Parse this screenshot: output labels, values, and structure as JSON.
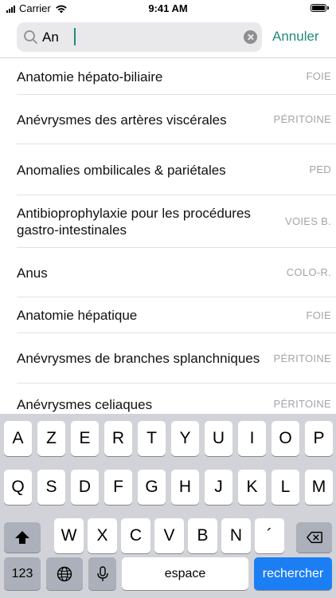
{
  "status_bar": {
    "carrier": "Carrier",
    "time": "9:41 AM"
  },
  "search": {
    "value": "An",
    "cancel_label": "Annuler"
  },
  "results": [
    {
      "title": "Anatomie hépato-biliaire",
      "category": "FOIE"
    },
    {
      "title": "Anévrysmes des artères viscérales",
      "category": "PÉRITOINE"
    },
    {
      "title": "Anomalies ombilicales & pariétales",
      "category": "PED"
    },
    {
      "title": "Antibioprophylaxie pour les procédures gastro-intestinales",
      "category": "VOIES B."
    },
    {
      "title": "Anus",
      "category": "COLO-R."
    },
    {
      "title": "Anatomie hépatique",
      "category": "FOIE"
    },
    {
      "title": "Anévrysmes de branches splanchniques",
      "category": "PÉRITOINE"
    },
    {
      "title": "Anévrysmes celiaques",
      "category": "PÉRITOINE"
    }
  ],
  "keyboard": {
    "row1": [
      "A",
      "Z",
      "E",
      "R",
      "T",
      "Y",
      "U",
      "I",
      "O",
      "P"
    ],
    "row2": [
      "Q",
      "S",
      "D",
      "F",
      "G",
      "H",
      "J",
      "K",
      "L",
      "M"
    ],
    "row3": [
      "W",
      "X",
      "C",
      "V",
      "B",
      "N",
      "´"
    ],
    "numbers_label": "123",
    "space_label": "espace",
    "search_label": "rechercher"
  },
  "colors": {
    "accent": "#1f8a7e",
    "keyboard_bg": "#d1d3d9",
    "action_key": "#1c7ef3"
  }
}
